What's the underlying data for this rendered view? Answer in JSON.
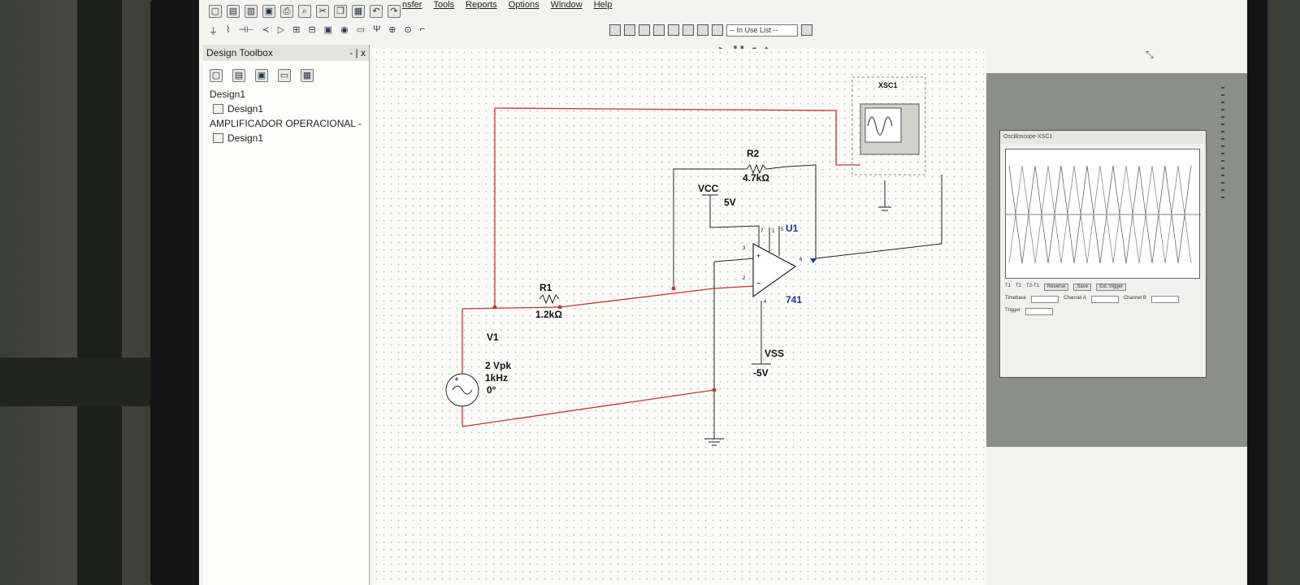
{
  "menu": {
    "items": [
      "nsfer",
      "Tools",
      "Reports",
      "Options",
      "Window",
      "Help"
    ]
  },
  "toolbar": {
    "in_use_list": "-- In Use List --"
  },
  "toolbox": {
    "title": "Design Toolbox",
    "close_glyphs": "- | x",
    "tree": [
      "Design1",
      "Design1",
      "AMPLIFICADOR OPERACIONAL -",
      "Design1"
    ]
  },
  "circuit": {
    "r1_name": "R1",
    "r1_value": "1.2kΩ",
    "r2_name": "R2",
    "r2_value": "4.7kΩ",
    "vcc_name": "VCC",
    "vcc_value": "5V",
    "vss_name": "VSS",
    "vss_value": "-5V",
    "opamp_name": "U1",
    "opamp_model": "741",
    "source_name": "V1",
    "source_amplitude": "2 Vpk",
    "source_freq": "1kHz",
    "source_phase": "0°",
    "scope_name": "XSC1",
    "pin3": "3",
    "pin2": "2",
    "pin7": "7",
    "pin4": "4",
    "pin6": "6",
    "pin1": "1",
    "pin5": "5"
  },
  "scope": {
    "title": "Oscilloscope-XSC1",
    "reverse_label": "Reverse",
    "save_label": "Save",
    "ext_trigger_label": "Ext. trigger",
    "timebase_label": "Timebase",
    "channel_a_label": "Channel A",
    "channel_b_label": "Channel B",
    "trigger_label": "Trigger",
    "row_labels": [
      "T1",
      "T2",
      "T2-T1"
    ]
  },
  "colors": {
    "wire": "#c0392b",
    "component": "#1a1a1a",
    "label_blue": "#1a3aa0"
  }
}
